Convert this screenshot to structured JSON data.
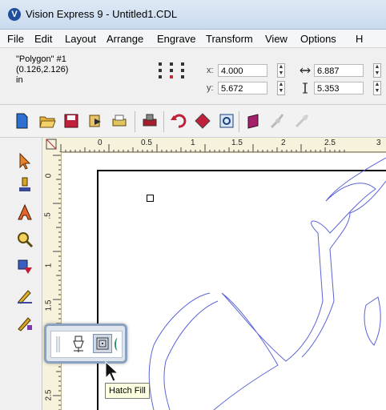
{
  "window": {
    "title": "Vision Express 9 - Untitled1.CDL",
    "app_icon_glyph": "V"
  },
  "menu": [
    "File",
    "Edit",
    "Layout",
    "Arrange",
    "Engrave",
    "Transform",
    "View",
    "Options",
    "H"
  ],
  "object_info": {
    "name": "\"Polygon\" #1",
    "position": "(0.126,2.126)",
    "units": "in"
  },
  "coords": {
    "x_label": "x:",
    "x_value": "4.000",
    "y_label": "y:",
    "y_value": "5.672",
    "w_value": "6.887",
    "h_value": "5.353"
  },
  "ruler": {
    "h_labels": [
      "0",
      "0.5",
      "1",
      "1.5",
      "2",
      "2.5",
      "3"
    ],
    "v_labels": [
      "0",
      ".5",
      "1",
      "1.5",
      "2",
      "2.5"
    ]
  },
  "tooltip": "Hatch Fill",
  "colors": {
    "shape_stroke": "#5b64d6"
  }
}
